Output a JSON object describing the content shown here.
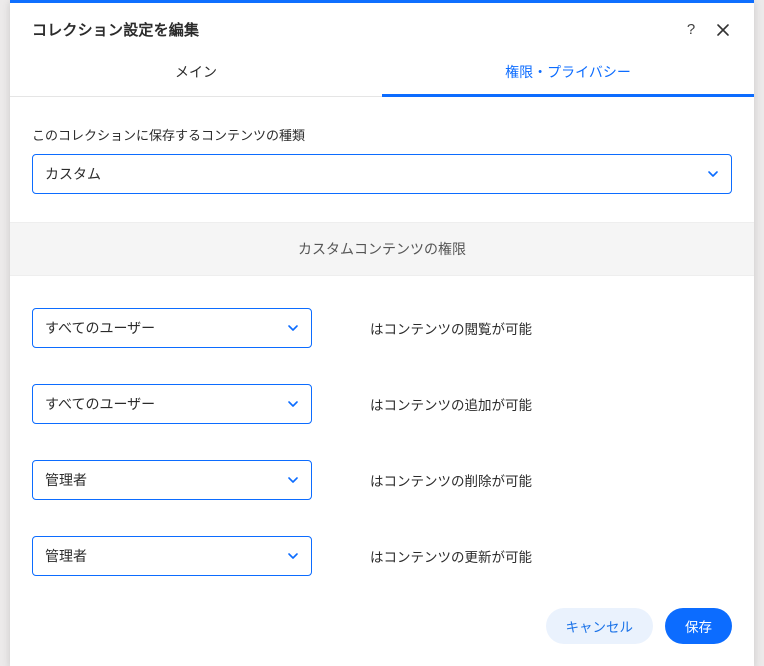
{
  "modal": {
    "title": "コレクション設定を編集",
    "help_label": "?",
    "close_label": "×"
  },
  "tabs": {
    "main": "メイン",
    "permissions": "権限・プライバシー",
    "active": "permissions"
  },
  "content_type": {
    "label": "このコレクションに保存するコンテンツの種類",
    "selected": "カスタム"
  },
  "permissions_header": "カスタムコンテンツの権限",
  "permissions": [
    {
      "role": "すべてのユーザー",
      "desc": "はコンテンツの閲覧が可能"
    },
    {
      "role": "すべてのユーザー",
      "desc": "はコンテンツの追加が可能"
    },
    {
      "role": "管理者",
      "desc": "はコンテンツの削除が可能"
    },
    {
      "role": "管理者",
      "desc": "はコンテンツの更新が可能"
    }
  ],
  "footer": {
    "cancel": "キャンセル",
    "save": "保存"
  },
  "colors": {
    "primary": "#0c6cff"
  }
}
